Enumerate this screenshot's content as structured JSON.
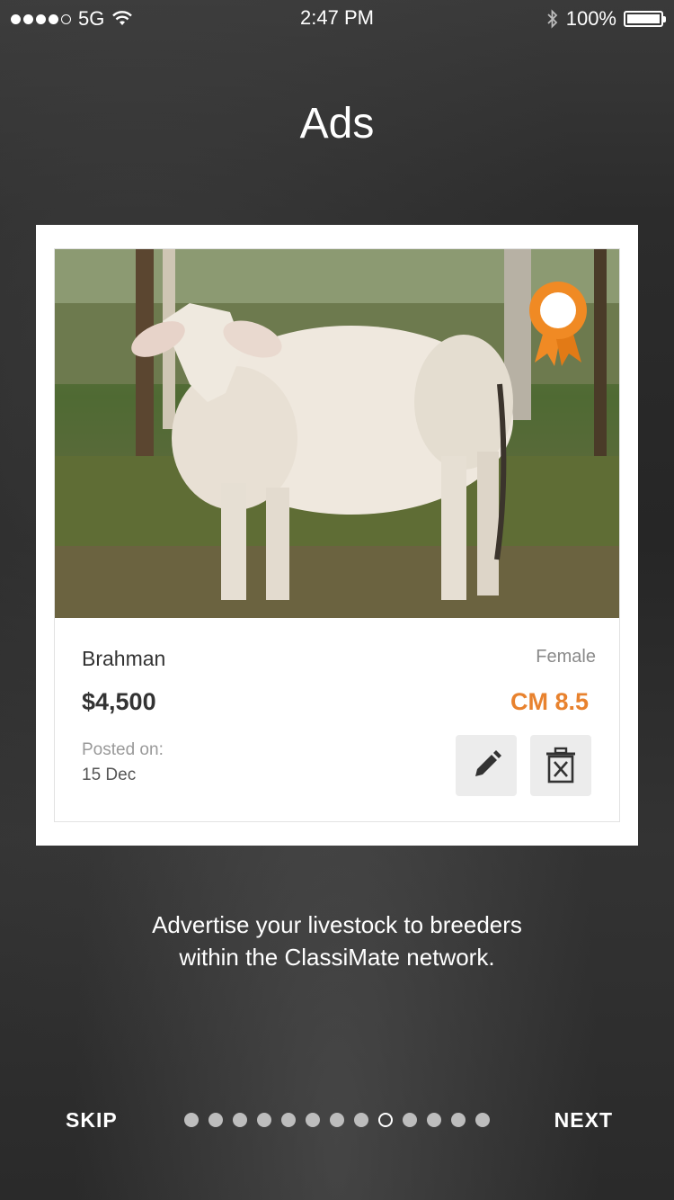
{
  "status_bar": {
    "carrier": "5G",
    "signal_bars": 4,
    "signal_total": 5,
    "time": "2:47 PM",
    "battery": "100%",
    "battery_level": 1.0
  },
  "page": {
    "title": "Ads"
  },
  "ad_card": {
    "breed": "Brahman",
    "sex": "Female",
    "price": "$4,500",
    "cm": "CM 8.5",
    "posted_label": "Posted on:",
    "posted_date": "15 Dec",
    "ribbon_color": "#f08a24",
    "accent_color": "#e8822e",
    "icons": {
      "edit": "pencil-icon",
      "delete": "trash-icon",
      "award": "award-ribbon-icon"
    }
  },
  "caption": {
    "line1": "Advertise your livestock to breeders",
    "line2": "within the ClassiMate network."
  },
  "navigation": {
    "skip_label": "SKIP",
    "next_label": "NEXT",
    "page_count": 13,
    "active_page": 9
  }
}
